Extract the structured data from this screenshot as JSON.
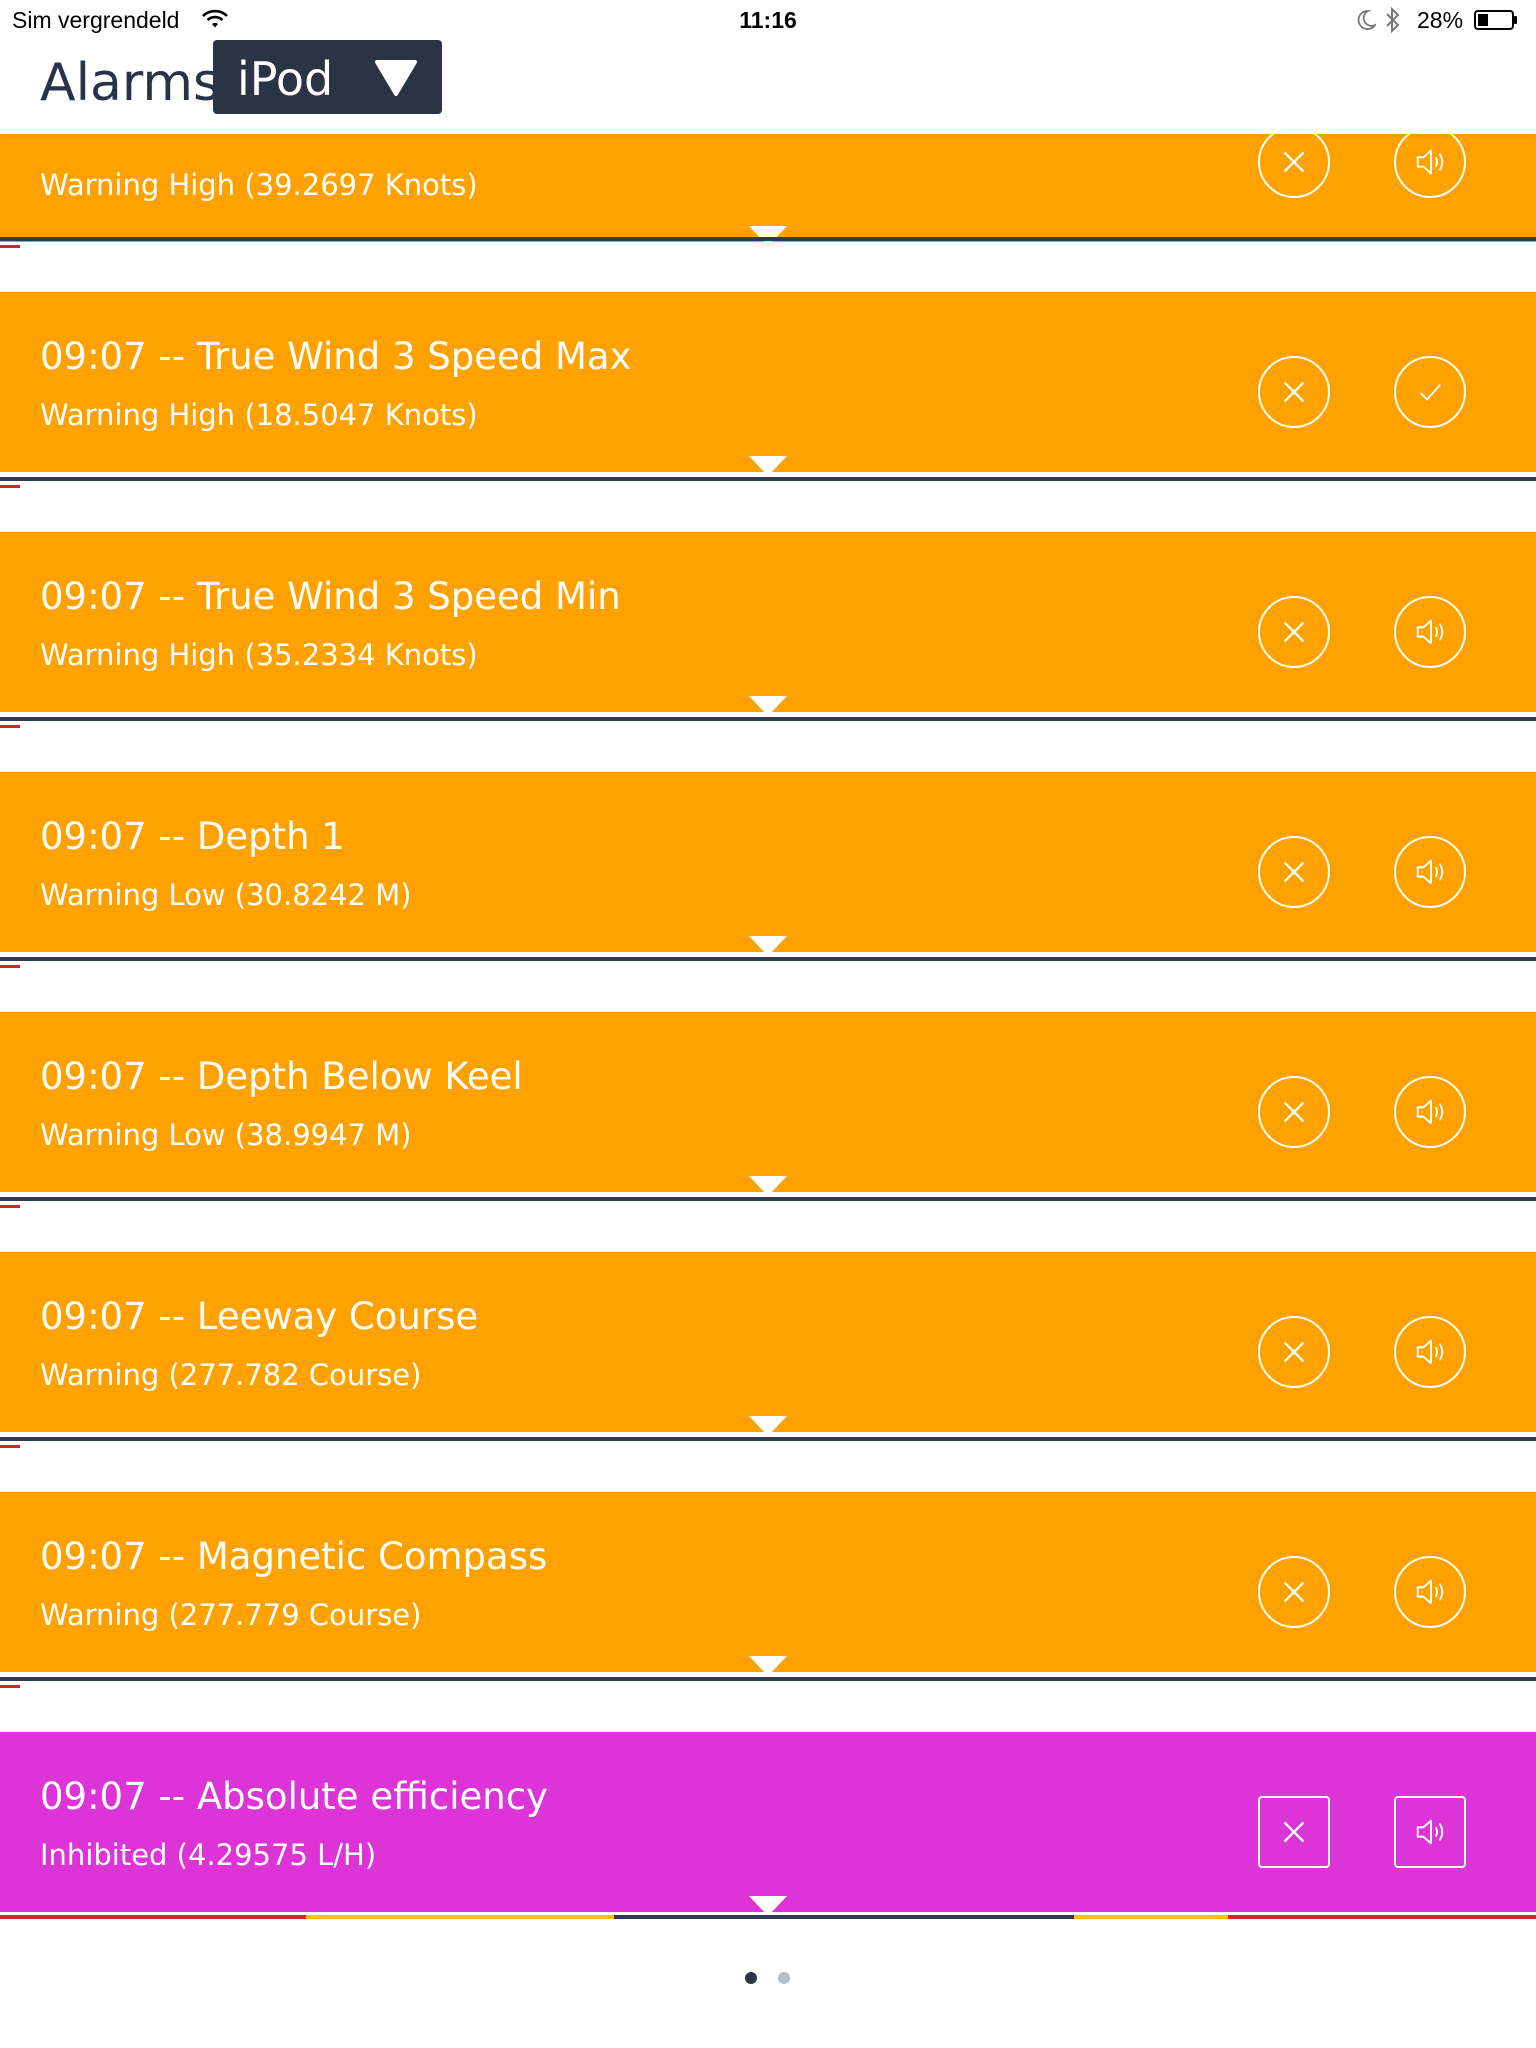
{
  "status_bar": {
    "carrier": "Sim vergrendeld",
    "time": "11:16",
    "battery": "28%"
  },
  "header": {
    "title": "Alarms",
    "device": "iPod"
  },
  "colors": {
    "warning": "#ffa200",
    "inhibited": "#dd34d8",
    "header_button": "#2b3445",
    "divider": "#2f3a50"
  },
  "alarms": [
    {
      "title": "",
      "subtitle": "Warning High (39.2697 Knots)",
      "action_icon": "speaker-icon",
      "state": "warning"
    },
    {
      "title": "09:07 -- True Wind 3 Speed Max",
      "subtitle": "Warning High (18.5047 Knots)",
      "action_icon": "checkmark-icon",
      "state": "warning"
    },
    {
      "title": "09:07 -- True Wind 3 Speed Min",
      "subtitle": "Warning High (35.2334 Knots)",
      "action_icon": "speaker-icon",
      "state": "warning"
    },
    {
      "title": "09:07 -- Depth 1",
      "subtitle": "Warning Low (30.8242 M)",
      "action_icon": "speaker-icon",
      "state": "warning"
    },
    {
      "title": "09:07 -- Depth Below Keel",
      "subtitle": "Warning Low (38.9947 M)",
      "action_icon": "speaker-icon",
      "state": "warning"
    },
    {
      "title": "09:07 -- Leeway Course",
      "subtitle": "Warning (277.782 Course)",
      "action_icon": "speaker-icon",
      "state": "warning"
    },
    {
      "title": "09:07 -- Magnetic Compass",
      "subtitle": "Warning (277.779 Course)",
      "action_icon": "speaker-icon",
      "state": "warning"
    },
    {
      "title": "09:07 -- Absolute efficiency",
      "subtitle": "Inhibited (4.29575 L/H)",
      "action_icon": "speaker-icon",
      "state": "inhibited"
    }
  ],
  "pager": {
    "pages": 2,
    "current": 1
  }
}
